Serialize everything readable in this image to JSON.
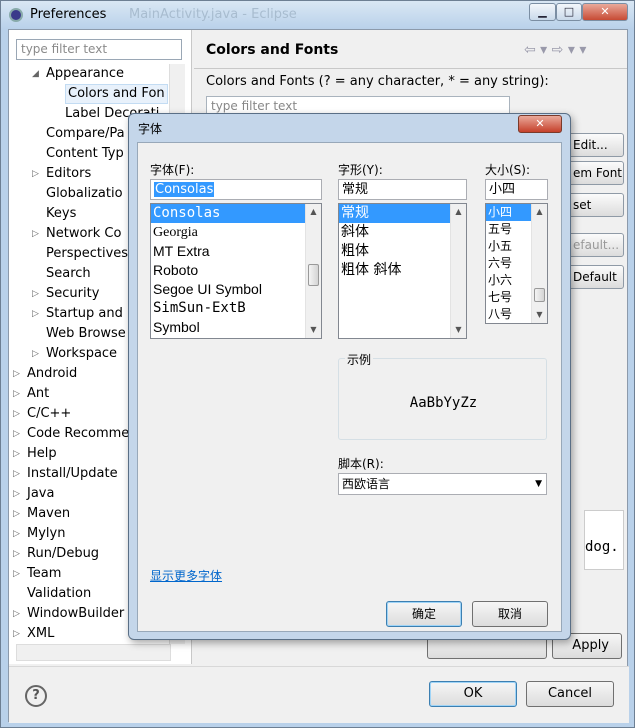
{
  "window": {
    "title": "Preferences",
    "bg_title": "MainActivity.java - Eclipse",
    "min": "▁",
    "max": "□",
    "close": "✕"
  },
  "left": {
    "filter_placeholder": "type filter text",
    "items": [
      "Appearance",
      "Colors and Fon",
      "Label Decorati",
      "Compare/Pa",
      "Content Typ",
      "Editors",
      "Globalizatio",
      "Keys",
      "Network Co",
      "Perspectives",
      "Search",
      "Security",
      "Startup and",
      "Web Browse",
      "Workspace",
      "Android",
      "Ant",
      "C/C++",
      "Code Recomme",
      "Help",
      "Install/Update",
      "Java",
      "Maven",
      "Mylyn",
      "Run/Debug",
      "Team",
      "Validation",
      "WindowBuilder",
      "XML"
    ]
  },
  "right": {
    "title": "Colors and Fonts",
    "desc": "Colors and Fonts (? = any character, * = any string):",
    "filter_placeholder": "type filter text",
    "btn_edit": "Edit...",
    "btn_system_font": "em Font",
    "btn_reset": "set",
    "btn_edit_default": "efault...",
    "btn_go_default": "Default",
    "preview_text": "dog.",
    "apply": "Apply"
  },
  "bottom": {
    "help": "?",
    "ok": "OK",
    "cancel": "Cancel"
  },
  "font_dialog": {
    "title": "字体",
    "close": "✕",
    "font_label": "字体(F):",
    "font_value": "Consolas",
    "fonts": [
      "Consolas",
      "Georgia",
      "MT Extra",
      "Roboto",
      "Segoe UI Symbol",
      "SimSun-ExtB",
      "Symbol"
    ],
    "style_label": "字形(Y):",
    "style_value": "常规",
    "styles": [
      "常规",
      "斜体",
      "粗体",
      "粗体 斜体"
    ],
    "size_label": "大小(S):",
    "size_value": "小四",
    "sizes": [
      "小四",
      "五号",
      "小五",
      "六号",
      "小六",
      "七号",
      "八号"
    ],
    "sample_label": "示例",
    "sample_text": "AaBbYyZz",
    "script_label": "脚本(R):",
    "script_value": "西欧语言",
    "more_fonts": "显示更多字体",
    "ok": "确定",
    "cancel": "取消"
  }
}
